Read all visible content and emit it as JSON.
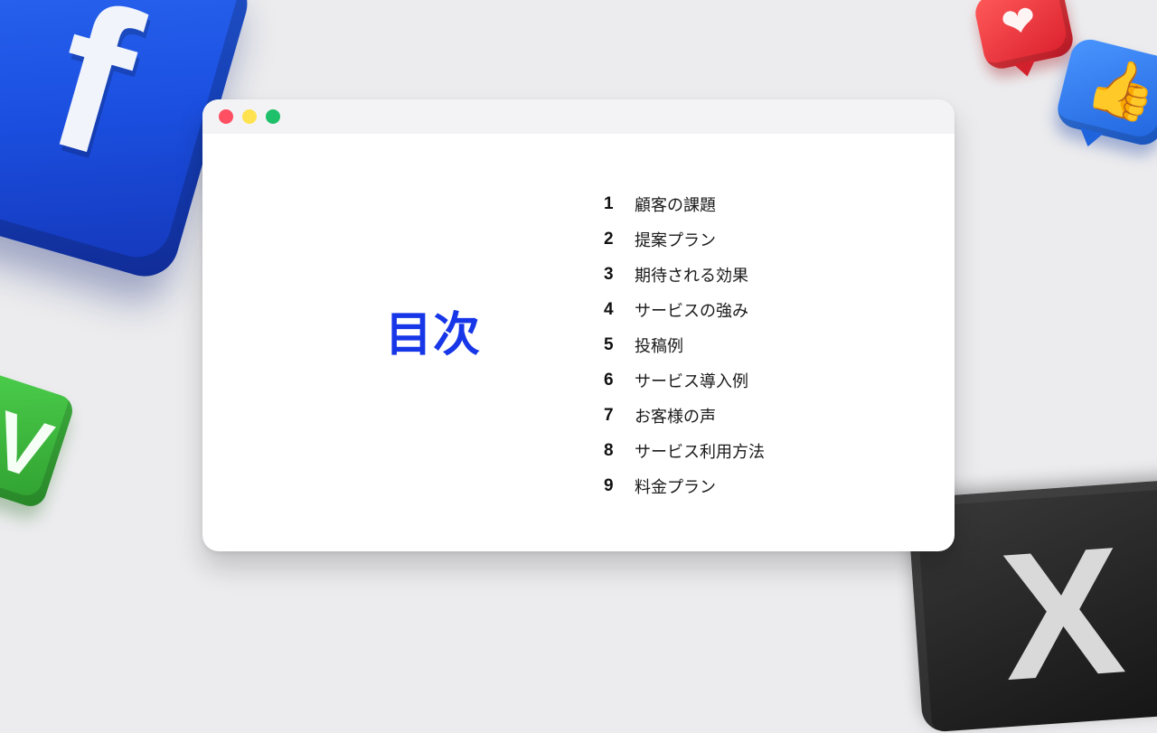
{
  "window": {
    "controls": [
      "close",
      "minimize",
      "maximize"
    ]
  },
  "heading": "目次",
  "toc": [
    {
      "num": "1",
      "label": "顧客の課題"
    },
    {
      "num": "2",
      "label": "提案プラン"
    },
    {
      "num": "3",
      "label": "期待される効果"
    },
    {
      "num": "4",
      "label": "サービスの強み"
    },
    {
      "num": "5",
      "label": "投稿例"
    },
    {
      "num": "6",
      "label": "サービス導入例"
    },
    {
      "num": "7",
      "label": "お客様の声"
    },
    {
      "num": "8",
      "label": "サービス利用方法"
    },
    {
      "num": "9",
      "label": "料金プラン"
    }
  ],
  "decorations": {
    "icons": [
      "facebook-icon",
      "heart-reaction-icon",
      "thumbs-up-like-icon",
      "vine-icon",
      "x-icon"
    ],
    "facebook_glyph": "f",
    "vine_glyph": "V",
    "x_glyph": "X"
  },
  "colors": {
    "accent": "#1636e8",
    "background": "#ececee",
    "dot_red": "#ff4f62",
    "dot_yellow": "#ffe24f",
    "dot_green": "#1fc06a"
  }
}
